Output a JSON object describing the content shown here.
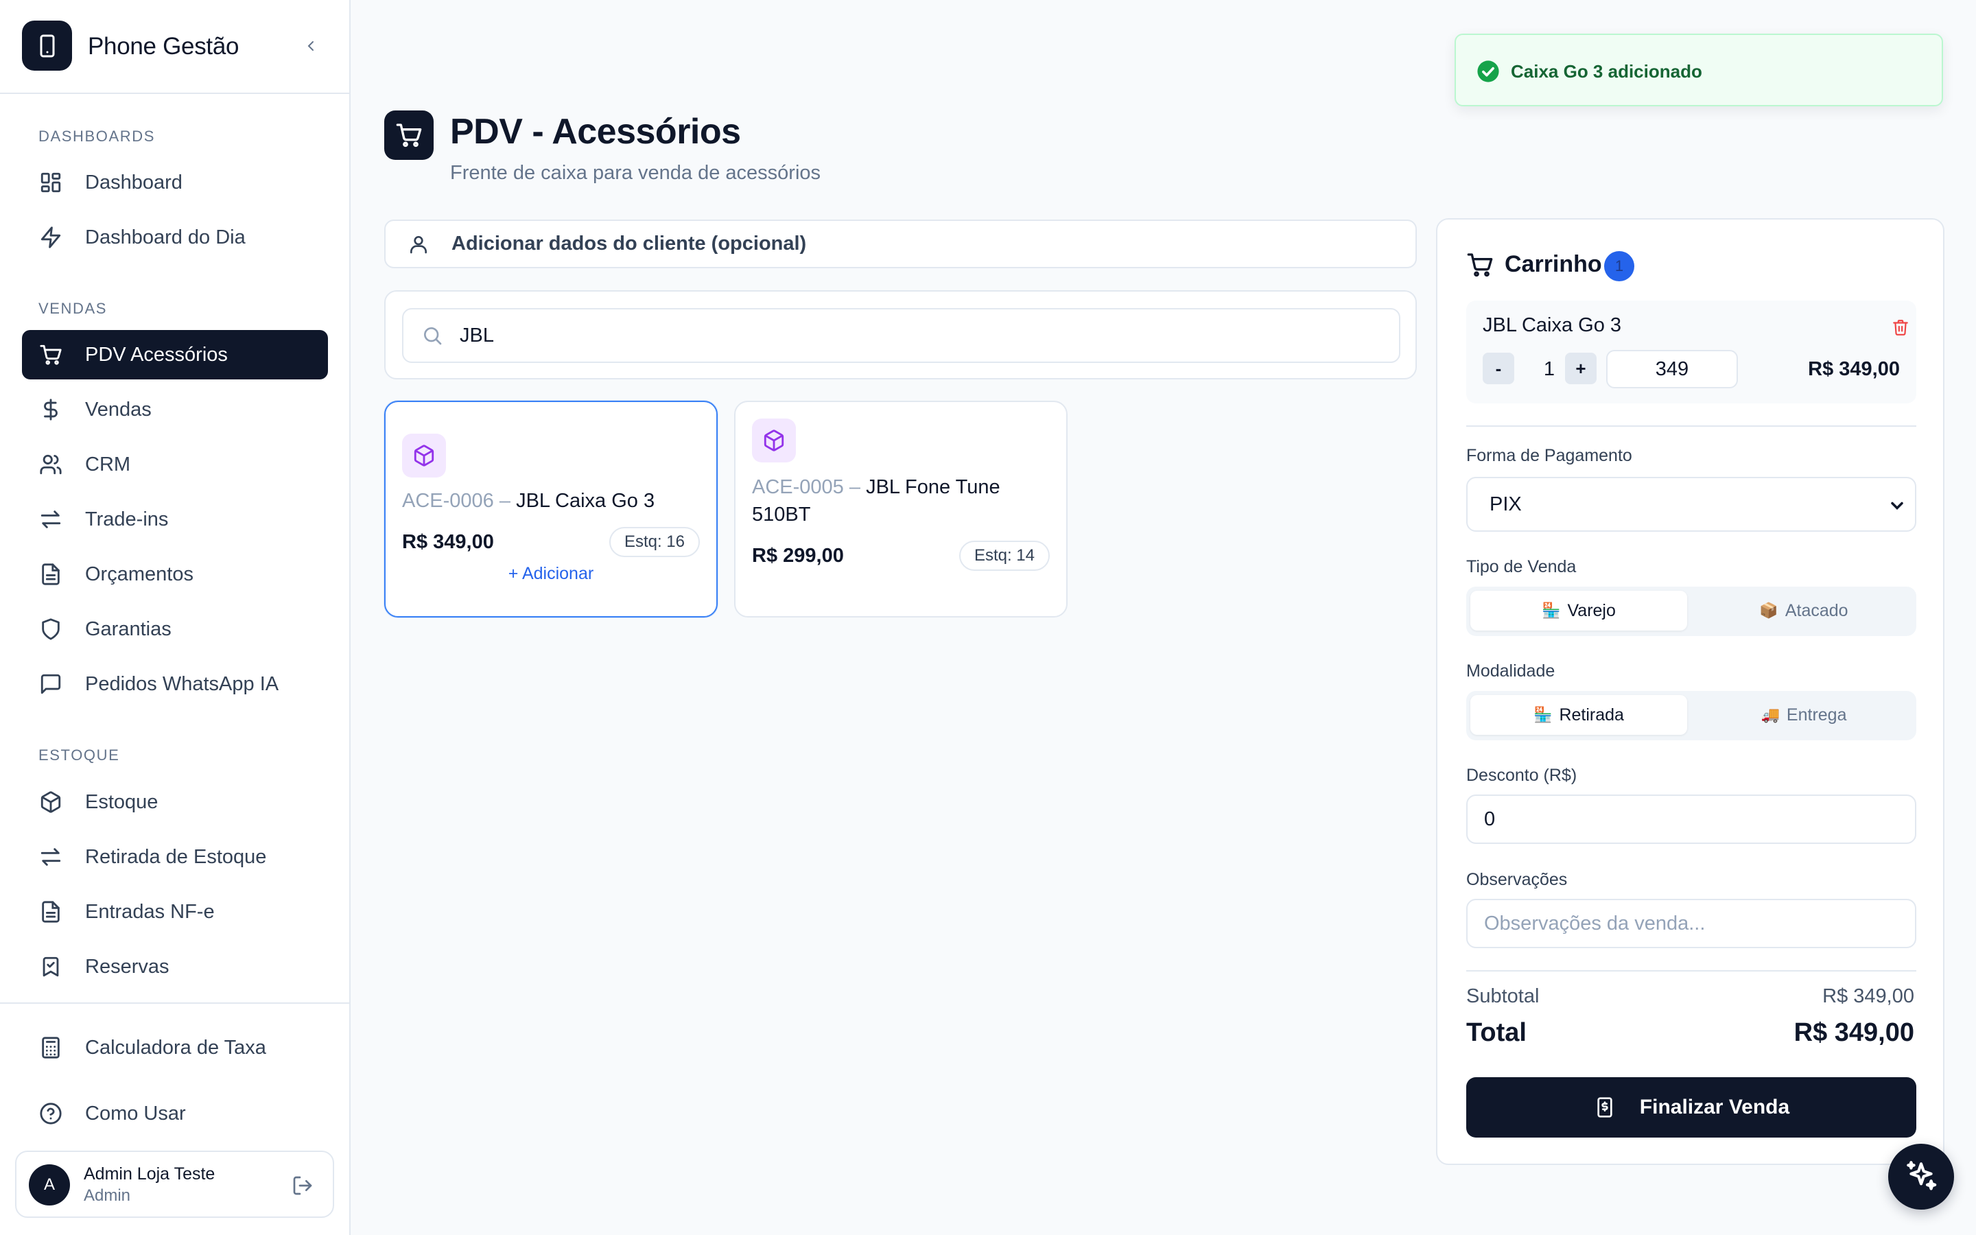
{
  "app": {
    "name": "Phone Gestão"
  },
  "sidebar": {
    "sections": {
      "dashboards": "Dashboards",
      "vendas": "Vendas",
      "estoque": "Estoque"
    },
    "items": {
      "dashboard": "Dashboard",
      "dashboard_dia": "Dashboard do Dia",
      "pdv": "PDV Acessórios",
      "vendas": "Vendas",
      "crm": "CRM",
      "trade_ins": "Trade-ins",
      "orcamentos": "Orçamentos",
      "garantias": "Garantias",
      "pedidos_whatsapp": "Pedidos WhatsApp IA",
      "estoque": "Estoque",
      "retirada": "Retirada de Estoque",
      "entradas": "Entradas NF-e",
      "reservas": "Reservas",
      "calculadora": "Calculadora de Taxa",
      "como_usar": "Como Usar"
    },
    "user": {
      "initial": "A",
      "name": "Admin Loja Teste",
      "role": "Admin"
    }
  },
  "page": {
    "title": "PDV - Acessórios",
    "subtitle": "Frente de caixa para venda de acessórios"
  },
  "client_bar": {
    "label": "Adicionar dados do cliente (opcional)"
  },
  "search": {
    "value": "JBL"
  },
  "products": [
    {
      "code": "ACE-0006 –",
      "name": "JBL Caixa Go 3",
      "price": "R$ 349,00",
      "stock": "Estq: 16",
      "add_label": "+ Adicionar"
    },
    {
      "code": "ACE-0005 –",
      "name": "JBL Fone Tune 510BT",
      "price": "R$ 299,00",
      "stock": "Estq: 14"
    }
  ],
  "cart": {
    "title": "Carrinho",
    "count": "1",
    "item": {
      "name": "JBL Caixa Go 3",
      "minus": "-",
      "qty": "1",
      "plus": "+",
      "unit_price": "349",
      "total": "R$ 349,00"
    },
    "payment": {
      "label": "Forma de Pagamento",
      "selected": "PIX"
    },
    "sale_type": {
      "label": "Tipo de Venda",
      "options": [
        "Varejo",
        "Atacado"
      ],
      "selected": "Varejo"
    },
    "modality": {
      "label": "Modalidade",
      "options": [
        "Retirada",
        "Entrega"
      ],
      "selected": "Retirada"
    },
    "discount": {
      "label": "Desconto (R$)",
      "value": "0"
    },
    "notes": {
      "label": "Observações",
      "placeholder": "Observações da venda..."
    },
    "subtotal": {
      "label": "Subtotal",
      "value": "R$ 349,00"
    },
    "total": {
      "label": "Total",
      "value": "R$ 349,00"
    },
    "finalize_label": "Finalizar Venda"
  },
  "toast": {
    "message": "Caixa Go 3 adicionado"
  },
  "colors": {
    "primary": "#0f172a",
    "accent": "#2563eb",
    "success": "#16a34a",
    "product_icon": "#9333ea",
    "danger": "#ef4444"
  }
}
